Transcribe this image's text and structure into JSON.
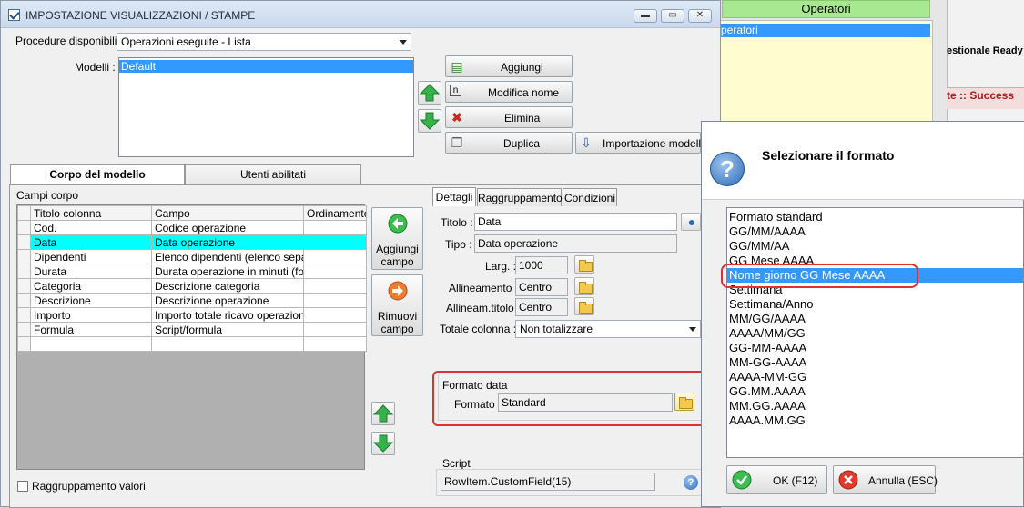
{
  "background_app": {
    "header": "Operatori",
    "list_selected": "peratori",
    "strip_text": "estionale Ready",
    "red_text": "te :: Success"
  },
  "window": {
    "title": "IMPOSTAZIONE VISUALIZZAZIONI / STAMPE",
    "controls": {
      "minimize": "▬",
      "restore": "▭",
      "close": "✕"
    }
  },
  "top": {
    "procedure_label": "Procedure disponibili :",
    "procedure_value": "Operazioni eseguite - Lista",
    "models_label": "Modelli :",
    "models": [
      "Default"
    ],
    "buttons": {
      "add": "Aggiungi",
      "rename": "Modifica nome",
      "delete": "Elimina",
      "duplicate": "Duplica",
      "import": "Importazione modello"
    }
  },
  "tabs": [
    "Corpo del modello",
    "Utenti abilitati"
  ],
  "body": {
    "section_label": "Campi corpo",
    "columns": [
      "Titolo colonna",
      "Campo",
      "Ordinamento"
    ],
    "rows": [
      {
        "title": "Cod.",
        "field": "Codice operazione",
        "order": ""
      },
      {
        "title": "Data",
        "field": "Data operazione",
        "order": ""
      },
      {
        "title": "Dipendenti",
        "field": "Elenco dipendenti (elenco separ...",
        "order": ""
      },
      {
        "title": "Durata",
        "field": "Durata operazione in minuti (for...",
        "order": ""
      },
      {
        "title": "Categoria",
        "field": "Descrizione categoria",
        "order": ""
      },
      {
        "title": "Descrizione",
        "field": "Descrizione operazione",
        "order": ""
      },
      {
        "title": "Importo",
        "field": "Importo totale ricavo operazione...",
        "order": ""
      },
      {
        "title": "Formula",
        "field": "Script/formula",
        "order": ""
      },
      {
        "title": "",
        "field": "",
        "order": ""
      }
    ],
    "selected_row": 1,
    "add_field_button": [
      "Aggiungi",
      "campo"
    ],
    "remove_field_button": [
      "Rimuovi",
      "campo"
    ],
    "group_values_label": "Raggruppamento valori"
  },
  "detail_tabs": [
    "Dettagli",
    "Raggruppamento",
    "Condizioni"
  ],
  "details": {
    "title_label": "Titolo :",
    "title_value": "Data",
    "type_label": "Tipo :",
    "type_value": "Data operazione",
    "width_label": "Larg. :",
    "width_value": "1000",
    "align_label": "Allineamento :",
    "align_value": "Centro",
    "title_align_label": "Allineam.titolo :",
    "title_align_value": "Centro",
    "total_label": "Totale colonna :",
    "total_value": "Non totalizzare",
    "date_format_group": "Formato data",
    "format_label": "Formato :",
    "format_value": "Standard",
    "script_label": "Script",
    "script_value": "RowItem.CustomField(15)"
  },
  "dialog": {
    "title": "Selezionare il formato",
    "formats": [
      "Formato standard",
      "GG/MM/AAAA",
      "GG/MM/AA",
      "GG Mese AAAA",
      "Nome giorno GG Mese AAAA",
      "Settimana",
      "Settimana/Anno",
      "MM/GG/AAAA",
      "AAAA/MM/GG",
      "GG-MM-AAAA",
      "MM-GG-AAAA",
      "AAAA-MM-GG",
      "GG.MM.AAAA",
      "MM.GG.AAAA",
      "AAAA.MM.GG"
    ],
    "selected_index": 4,
    "ok_button": "OK (F12)",
    "cancel_button": "Annulla (ESC)"
  },
  "colors": {
    "selection": "#3399ff",
    "grid_selection": "#00ffff",
    "highlight_ring": "#e03030",
    "operatori_header": "#a8e890"
  }
}
